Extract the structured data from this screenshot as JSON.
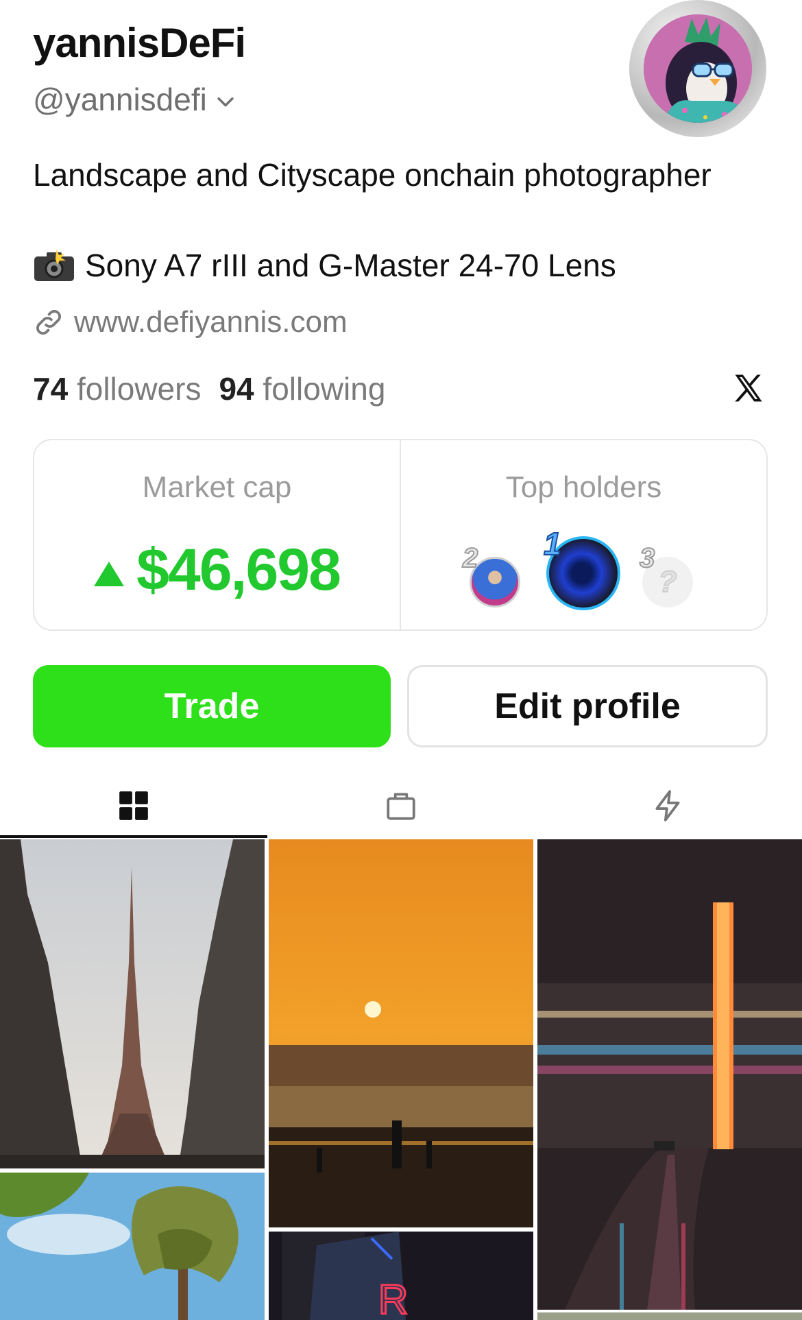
{
  "profile": {
    "display_name": "yannisDeFi",
    "handle": "@yannisdefi",
    "bio_line1": "Landscape and Cityscape onchain photographer",
    "bio_line2": "Sony A7 rIII and G-Master 24-70 Lens",
    "website": "www.defiyannis.com"
  },
  "social": {
    "followers_count": "74",
    "followers_label": "followers",
    "following_count": "94",
    "following_label": "following"
  },
  "stats": {
    "market_cap_label": "Market cap",
    "market_cap_value": "$46,698",
    "top_holders_label": "Top holders",
    "holder_ranks": [
      "2",
      "1",
      "3"
    ],
    "unknown_holder_glyph": "?"
  },
  "actions": {
    "trade_label": "Trade",
    "edit_label": "Edit profile"
  },
  "tabs": [
    {
      "icon": "grid-icon",
      "active": true
    },
    {
      "icon": "bag-icon",
      "active": false
    },
    {
      "icon": "lightning-icon",
      "active": false
    }
  ],
  "colors": {
    "accent_green": "#2ee01a",
    "market_green": "#22c92e",
    "avatar_bg": "#c86fb0"
  }
}
